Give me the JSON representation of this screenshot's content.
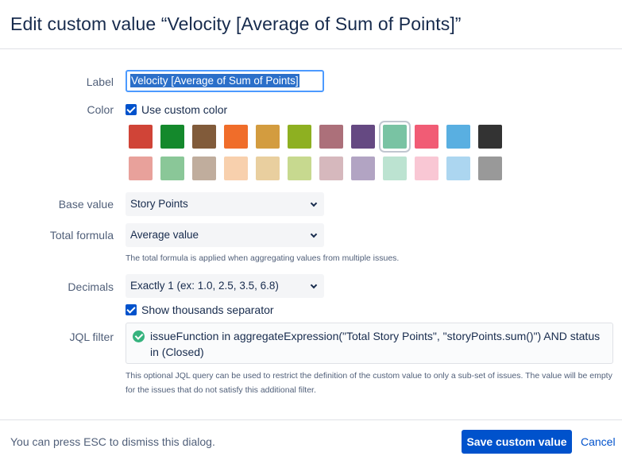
{
  "dialog": {
    "title": "Edit custom value “Velocity [Average of Sum of Points]”"
  },
  "fields": {
    "label": {
      "label": "Label",
      "value": "Velocity [Average of Sum of Points]"
    },
    "color": {
      "label": "Color",
      "use_custom_label": "Use custom color",
      "use_custom_checked": true,
      "swatches_row1": [
        "#d04437",
        "#14892c",
        "#815b3a",
        "#f06d2a",
        "#d39c3f",
        "#8eb021",
        "#ac707a",
        "#654982",
        "#79c3a3",
        "#f15c75",
        "#59afe1",
        "#333333"
      ],
      "swatches_row2": [
        "#e8a19b",
        "#8ac798",
        "#c0ad9d",
        "#f8d0ad",
        "#e9cf9f",
        "#c7d98f",
        "#d6b8bd",
        "#b2a4c3",
        "#bce3d1",
        "#f9c7d4",
        "#acd6f0",
        "#999999"
      ],
      "selected_swatch": "#79c3a3"
    },
    "base_value": {
      "label": "Base value",
      "selected": "Story Points"
    },
    "total_formula": {
      "label": "Total formula",
      "selected": "Average value",
      "help": "The total formula is applied when aggregating values from multiple issues."
    },
    "decimals": {
      "label": "Decimals",
      "selected": "Exactly 1 (ex: 1.0, 2.5, 3.5, 6.8)",
      "thousands_label": "Show thousands separator",
      "thousands_checked": true
    },
    "jql_filter": {
      "label": "JQL filter",
      "value": "issueFunction in aggregateExpression(\"Total Story Points\", \"storyPoints.sum()\") AND status in (Closed)",
      "help": "This optional JQL query can be used to restrict the definition of the custom value to only a sub-set of issues. The value will be empty for the issues that do not satisfy this additional filter."
    }
  },
  "footer": {
    "hint": "You can press ESC to dismiss this dialog.",
    "save_label": "Save custom value",
    "cancel_label": "Cancel"
  }
}
